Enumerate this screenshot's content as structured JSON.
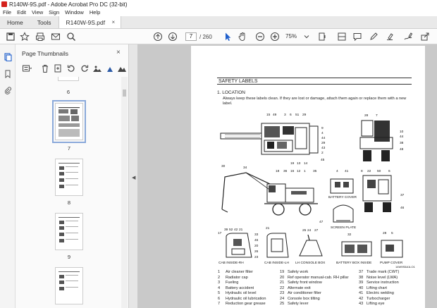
{
  "window": {
    "title": "R140W-9S.pdf - Adobe Acrobat Pro DC (32-bit)"
  },
  "menu": [
    "File",
    "Edit",
    "View",
    "Sign",
    "Window",
    "Help"
  ],
  "tabs": {
    "home": "Home",
    "tools": "Tools",
    "document": "R140W-9S.pdf",
    "close": "×"
  },
  "toolbar": {
    "page_current": "7",
    "page_total": "/ 260",
    "zoom": "75%"
  },
  "panel": {
    "title": "Page Thumbnails",
    "close": "×",
    "thumb_labels": [
      "6",
      "7",
      "8",
      "9"
    ]
  },
  "document": {
    "section_title": "SAFETY LABELS",
    "location_heading": "1.  LOCATION",
    "intro": "Always keep these labels clean.  If they are lost or damage, attach them again or replace them with a new label.",
    "callouts": {
      "top_left": [
        "15",
        "49",
        "3",
        "6",
        "51",
        "29"
      ],
      "top_left_right": [
        "9",
        "4",
        "44",
        "29",
        "43",
        "2"
      ],
      "top_left_bottom": [
        "19",
        "13",
        "14",
        "45"
      ],
      "top_right_top": [
        "28",
        "7"
      ],
      "top_right_right": [
        "10",
        "44",
        "38",
        "48"
      ],
      "mid_left_top": [
        "30",
        "34"
      ],
      "mid_left_row": [
        "18",
        "36",
        "16",
        "12",
        "1",
        "35"
      ],
      "mid_mid_top": [
        "4",
        "41"
      ],
      "mid_right_top": [
        "8",
        "22",
        "50",
        "6"
      ],
      "mid_right_right": [
        "37",
        "46"
      ],
      "battery_cover": "BATTERY COVER",
      "screen_plate": "SCREEN PLATE",
      "screen_num": "47",
      "cab_inside_rh_nums": [
        "17",
        "39",
        "52",
        "42",
        "21",
        "33",
        "46",
        "20",
        "26",
        "23",
        "32"
      ],
      "cab_inside_lh_num": "21",
      "lh_console_nums": [
        "25",
        "24",
        "27"
      ],
      "battery_box_nums": [
        "32"
      ],
      "pump_cover_nums": [
        "28",
        "5"
      ],
      "cab_inside_rh": "CAB INSIDE-RH",
      "cab_inside_lh": "CAB INSIDE-LH",
      "lh_console": "LH CONSOLE BOX",
      "battery_box_inside": "BATTERY BOX INSIDE",
      "pump_cover": "PUMP COVER",
      "drawing_code": "14W9S5A1LO1"
    },
    "legend_col1": [
      [
        "1",
        "Air cleaner filter"
      ],
      [
        "2",
        "Radiator cap"
      ],
      [
        "3",
        "Fueling"
      ],
      [
        "4",
        "Battery accident"
      ],
      [
        "5",
        "Hydraulic oil level"
      ],
      [
        "6",
        "Hydraulic oil lubrication"
      ],
      [
        "7",
        "Reduction gear grease"
      ]
    ],
    "legend_col2": [
      [
        "19",
        "Safety work"
      ],
      [
        "20",
        "Ref operator manual-cab. RH pillar"
      ],
      [
        "21",
        "Safety front window"
      ],
      [
        "22",
        "Alternate exit"
      ],
      [
        "23",
        "Air conditioner filter"
      ],
      [
        "24",
        "Console box tilting"
      ],
      [
        "25",
        "Safety lever"
      ]
    ],
    "legend_col3": [
      [
        "37",
        "Trade mark (CWT)"
      ],
      [
        "38",
        "Noise level (LWA)"
      ],
      [
        "39",
        "Service instruction"
      ],
      [
        "40",
        "Lifting chart"
      ],
      [
        "41",
        "Electric welding"
      ],
      [
        "42",
        "Turbocharger"
      ],
      [
        "43",
        "Lifting eye"
      ]
    ]
  },
  "icons": [
    "home-save",
    "star-icon",
    "print-icon",
    "mail-icon",
    "search-icon",
    "up-arrow-icon",
    "down-arrow-icon",
    "cursor-icon",
    "hand-icon",
    "zoom-out-icon",
    "zoom-in-icon"
  ]
}
